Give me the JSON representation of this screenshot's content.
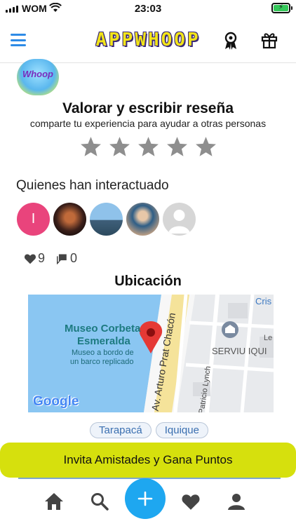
{
  "status_bar": {
    "carrier": "WOM",
    "time": "23:03"
  },
  "header": {
    "logo_text": "APPWHOOP",
    "menu_icon": "hamburger-menu-icon",
    "award_icon": "award-ribbon-icon",
    "gift_icon": "gift-icon"
  },
  "app": {
    "thumbnail_text": "Whoop"
  },
  "review": {
    "title": "Valorar y escribir reseña",
    "subtitle": "comparte tu experiencia para ayudar a otras personas",
    "stars": 5,
    "rating": 0
  },
  "interactions": {
    "title": "Quienes han interactuado",
    "users": [
      {
        "initial": "I",
        "type": "initial-avatar"
      },
      {
        "type": "photo-avatar"
      },
      {
        "type": "photo-avatar"
      },
      {
        "type": "photo-avatar"
      },
      {
        "type": "placeholder-avatar"
      }
    ]
  },
  "stats": {
    "likes": "9",
    "comments": "0"
  },
  "location": {
    "title": "Ubicación",
    "map": {
      "place_name_line1": "Museo Corbeta",
      "place_name_line2": "Esmeralda",
      "place_desc_line1": "Museo a bordo de",
      "place_desc_line2": "un barco replicado",
      "street_main": "Av. Arturo Prat Chacón",
      "street_side": "Patricio Lynch",
      "poi": "SERVIU IQUI",
      "corner_label": "Cris",
      "corner_label_2": "Le",
      "google_logo": "Google"
    },
    "tags": [
      "Tarapacá",
      "Iquique"
    ]
  },
  "invite": {
    "label": "Invita Amistades y Gana Puntos"
  },
  "bottom_nav": {
    "items": [
      "home-icon",
      "search-icon",
      "add-icon",
      "heart-icon",
      "profile-icon"
    ]
  },
  "colors": {
    "accent": "#2e8be6",
    "fab": "#1ea7f0",
    "invite_bg": "#d6e00d",
    "logo_yellow": "#f2e419",
    "star_gray": "#8e8e8e"
  }
}
